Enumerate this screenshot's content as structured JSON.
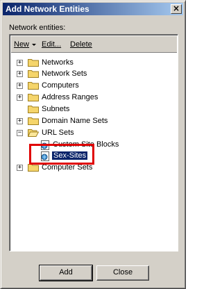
{
  "window": {
    "title": "Add Network Entities",
    "close_symbol": "×"
  },
  "section_label": "Network entities:",
  "toolbar": {
    "new_label": "New",
    "edit_label": "Edit...",
    "delete_label": "Delete"
  },
  "tree": [
    {
      "label": "Networks",
      "expander": "+",
      "icon": "folder-icon"
    },
    {
      "label": "Network Sets",
      "expander": "+",
      "icon": "folder-icon"
    },
    {
      "label": "Computers",
      "expander": "+",
      "icon": "folder-icon"
    },
    {
      "label": "Address Ranges",
      "expander": "+",
      "icon": "folder-icon"
    },
    {
      "label": "Subnets",
      "expander": "",
      "icon": "folder-icon"
    },
    {
      "label": "Domain Name Sets",
      "expander": "+",
      "icon": "folder-icon"
    },
    {
      "label": "URL Sets",
      "expander": "−",
      "icon": "open-folder-icon"
    },
    {
      "label": "Custom Site Blocks",
      "icon": "url-set-icon"
    },
    {
      "label": "Sex-Sites",
      "icon": "url-set-icon",
      "selected": true
    },
    {
      "label": "Computer Sets",
      "expander": "+",
      "icon": "folder-icon"
    }
  ],
  "buttons": {
    "add_label": "Add",
    "close_label": "Close"
  },
  "colors": {
    "titlebar_start": "#0a246a",
    "titlebar_end": "#a6caf0",
    "selection": "#0a246a",
    "highlight_box": "#e00000",
    "folder": "#f5d56b"
  }
}
